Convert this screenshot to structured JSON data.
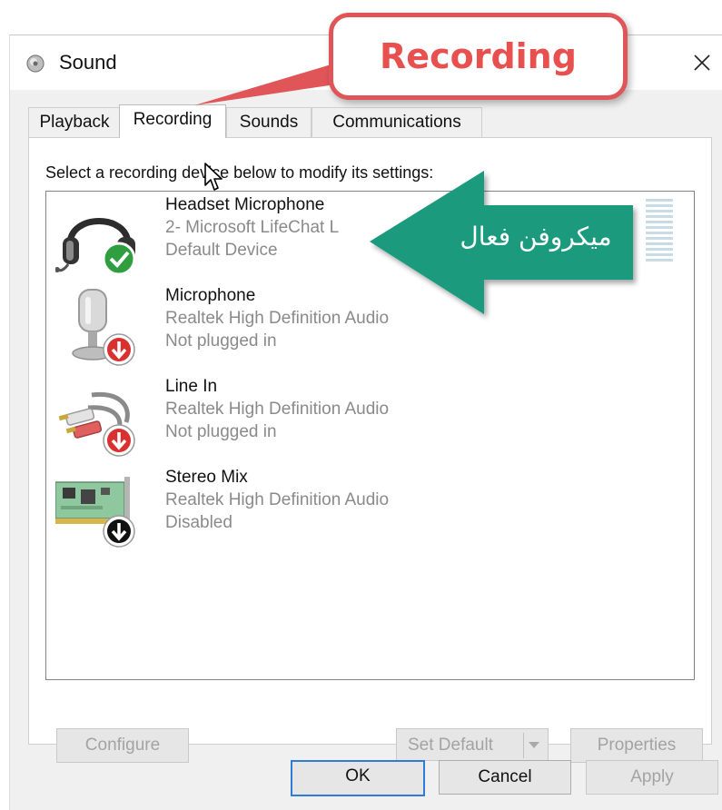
{
  "window": {
    "title": "Sound",
    "close_glyph": "✕"
  },
  "tabs": [
    {
      "label": "Playback",
      "active": false
    },
    {
      "label": "Recording",
      "active": true
    },
    {
      "label": "Sounds",
      "active": false
    },
    {
      "label": "Communications",
      "active": false
    }
  ],
  "instruction": "Select a recording device below to modify its settings:",
  "devices": [
    {
      "name": "Headset Microphone",
      "line2": "2- Microsoft LifeChat L",
      "status": "Default Device",
      "icon": "headset-icon",
      "badge": "check-badge-icon"
    },
    {
      "name": "Microphone",
      "line2": "Realtek High Definition Audio",
      "status": "Not plugged in",
      "icon": "microphone-icon",
      "badge": "red-down-arrow-badge-icon"
    },
    {
      "name": "Line In",
      "line2": "Realtek High Definition Audio",
      "status": "Not plugged in",
      "icon": "rca-cable-icon",
      "badge": "red-down-arrow-badge-icon"
    },
    {
      "name": "Stereo Mix",
      "line2": "Realtek High Definition Audio",
      "status": "Disabled",
      "icon": "sound-card-icon",
      "badge": "black-down-arrow-badge-icon"
    }
  ],
  "buttons": {
    "configure": "Configure",
    "set_default": "Set Default",
    "properties": "Properties",
    "ok": "OK",
    "cancel": "Cancel",
    "apply": "Apply"
  },
  "annotations": {
    "callout": "Recording",
    "arrow_label": "میکروفن فعال"
  },
  "colors": {
    "callout_red": "#e05658",
    "arrow_teal": "#1b9a7e",
    "ok_border": "#2f7bd6",
    "check_green": "#2e9e3e",
    "unplugged_red": "#d93030"
  }
}
